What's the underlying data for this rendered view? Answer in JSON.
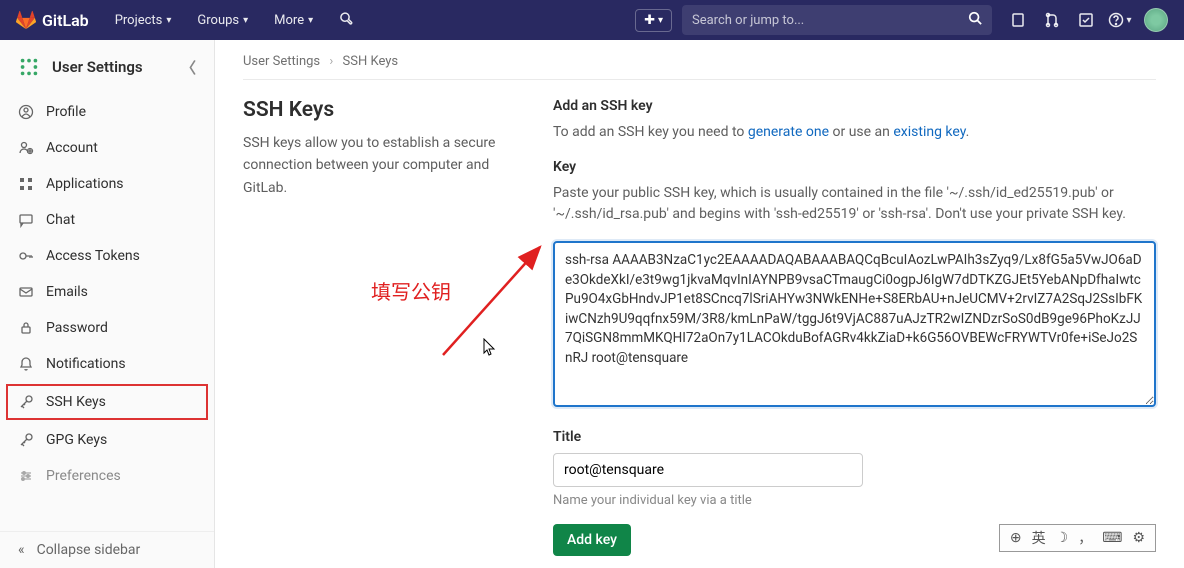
{
  "navbar": {
    "brand": "GitLab",
    "links": [
      "Projects",
      "Groups",
      "More"
    ],
    "search_placeholder": "Search or jump to..."
  },
  "sidebar": {
    "title": "User Settings",
    "items": [
      {
        "label": "Profile",
        "icon": "profile-icon"
      },
      {
        "label": "Account",
        "icon": "account-icon"
      },
      {
        "label": "Applications",
        "icon": "applications-icon"
      },
      {
        "label": "Chat",
        "icon": "chat-icon"
      },
      {
        "label": "Access Tokens",
        "icon": "token-icon"
      },
      {
        "label": "Emails",
        "icon": "email-icon"
      },
      {
        "label": "Password",
        "icon": "lock-icon"
      },
      {
        "label": "Notifications",
        "icon": "bell-icon"
      },
      {
        "label": "SSH Keys",
        "icon": "key-icon",
        "highlighted": true
      },
      {
        "label": "GPG Keys",
        "icon": "key-icon"
      },
      {
        "label": "Preferences",
        "icon": "preferences-icon"
      }
    ],
    "collapse": "Collapse sidebar"
  },
  "breadcrumb": {
    "a": "User Settings",
    "b": "SSH Keys"
  },
  "page": {
    "title": "SSH Keys",
    "desc": "SSH keys allow you to establish a secure connection between your computer and GitLab."
  },
  "form": {
    "add_heading": "Add an SSH key",
    "add_text_pre": "To add an SSH key you need to ",
    "add_link1": "generate one",
    "add_text_mid": " or use an ",
    "add_link2": "existing key",
    "add_text_end": ".",
    "key_label": "Key",
    "key_help": "Paste your public SSH key, which is usually contained in the file '~/.ssh/id_ed25519.pub' or '~/.ssh/id_rsa.pub' and begins with 'ssh-ed25519' or 'ssh-rsa'. Don't use your private SSH key.",
    "key_value": "ssh-rsa AAAAB3NzaC1yc2EAAAADAQABAAABAQCqBcuIAozLwPAIh3sZyq9/Lx8fG5a5VwJO6aDe3OkdeXkI/e3t9wg1jkvaMqvInIAYNPB9vsaCTmaugCi0ogpJ6IgW7dDTKZGJEt5YebANpDfhaIwtcPu9O4xGbHndvJP1et8SCncq7lSriAHYw3NWkENHe+S8ERbAU+nJeUCMV+2rvIZ7A2SqJ2SsIbFKiwCNzh9U9qqfnx59M/3R8/kmLnPaW/tggJ6t9VjAC887uAJzTR2wIZNDzrSoS0dB9ge96PhoKzJJ7QiSGN8mmMKQHI72aOn7y1LACOkduBofAGRv4kkZiaD+k6G56OVBEWcFRYWTVr0fe+iSeJo2SnRJ root@tensquare",
    "title_label": "Title",
    "title_value": "root@tensquare",
    "title_hint": "Name your individual key via a title",
    "submit": "Add key"
  },
  "annotation": "填写公钥",
  "bottom_toolbar": {
    "lang": "英"
  }
}
